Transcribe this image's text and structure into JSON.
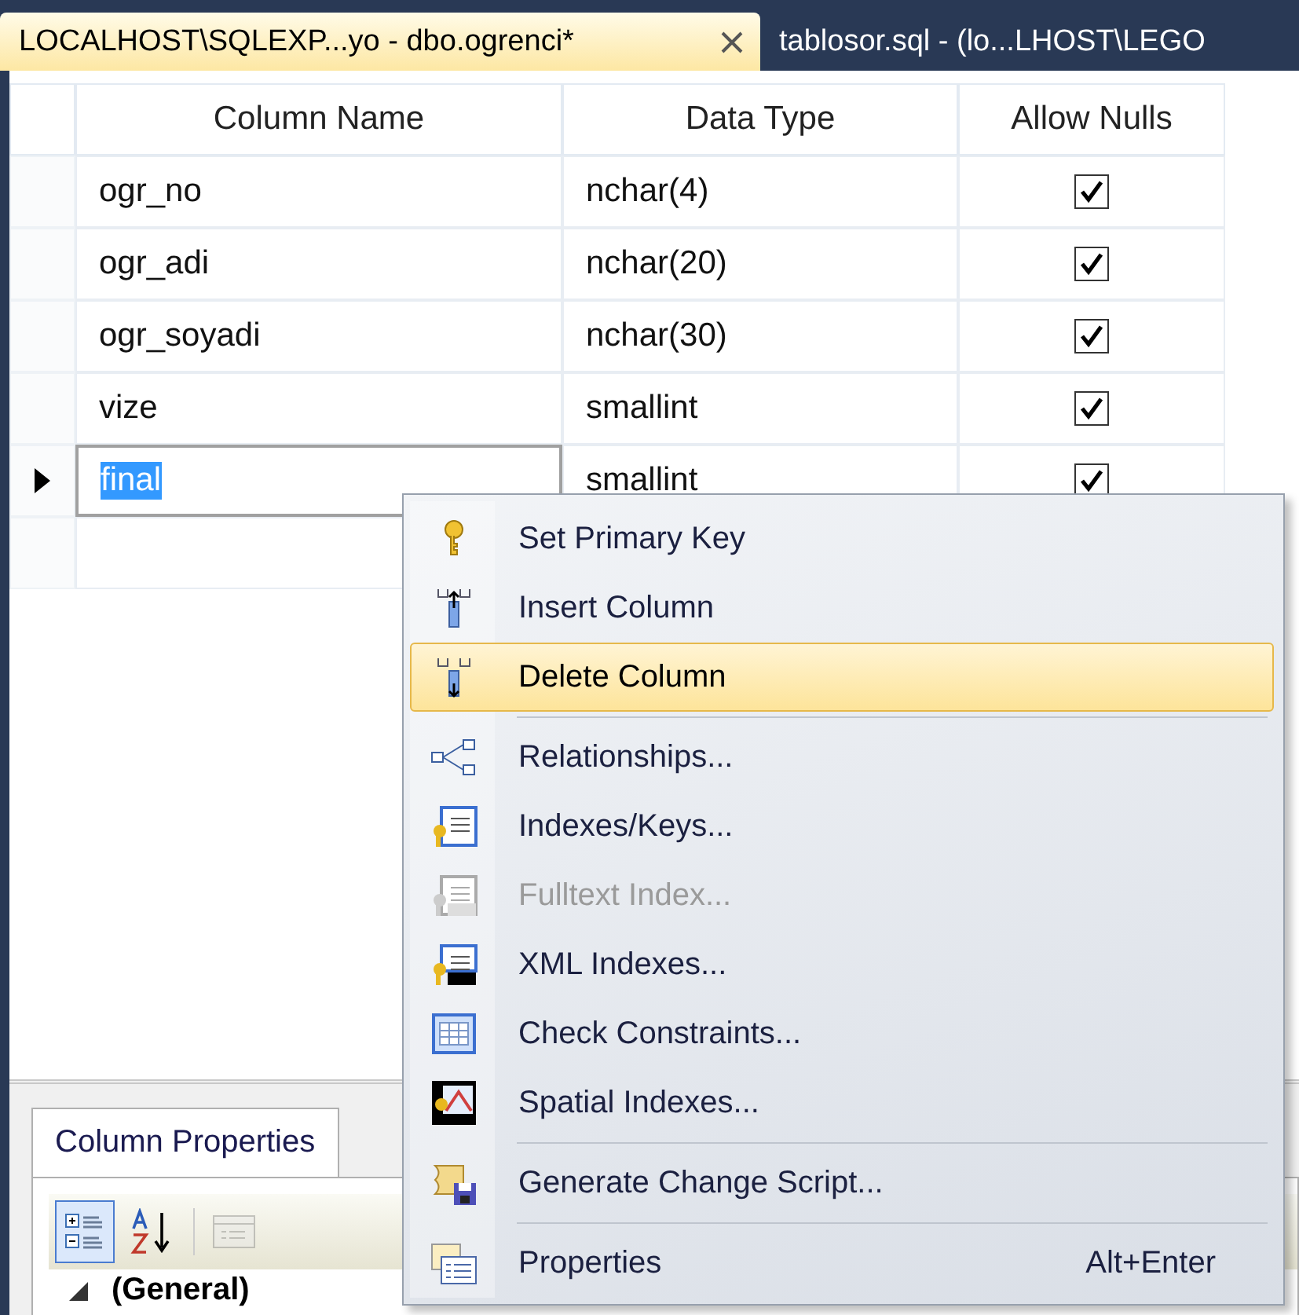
{
  "tabs": [
    {
      "title": "LOCALHOST\\SQLEXP...yo - dbo.ogrenci*",
      "selected": true,
      "closable": true
    },
    {
      "title": "tablosor.sql - (lo...LHOST\\LEGO",
      "selected": false,
      "closable": false
    }
  ],
  "table": {
    "columns": [
      "Column Name",
      "Data Type",
      "Allow Nulls"
    ],
    "rows": [
      {
        "name": "ogr_no",
        "type": "nchar(4)",
        "allow_nulls": true,
        "selected": false
      },
      {
        "name": "ogr_adi",
        "type": "nchar(20)",
        "allow_nulls": true,
        "selected": false
      },
      {
        "name": "ogr_soyadi",
        "type": "nchar(30)",
        "allow_nulls": true,
        "selected": false
      },
      {
        "name": "vize",
        "type": "smallint",
        "allow_nulls": true,
        "selected": false
      },
      {
        "name": "final",
        "type": "smallint",
        "allow_nulls": true,
        "selected": true
      }
    ]
  },
  "context_menu": {
    "items": [
      {
        "label": "Set Primary Key",
        "selected": false,
        "disabled": false,
        "separator_after": false
      },
      {
        "label": "Insert Column",
        "selected": false,
        "disabled": false,
        "separator_after": false
      },
      {
        "label": "Delete Column",
        "selected": true,
        "disabled": false,
        "separator_after": true
      },
      {
        "label": "Relationships...",
        "selected": false,
        "disabled": false,
        "separator_after": false
      },
      {
        "label": "Indexes/Keys...",
        "selected": false,
        "disabled": false,
        "separator_after": false
      },
      {
        "label": "Fulltext Index...",
        "selected": false,
        "disabled": true,
        "separator_after": false
      },
      {
        "label": "XML Indexes...",
        "selected": false,
        "disabled": false,
        "separator_after": false
      },
      {
        "label": "Check Constraints...",
        "selected": false,
        "disabled": false,
        "separator_after": false
      },
      {
        "label": "Spatial Indexes...",
        "selected": false,
        "disabled": false,
        "separator_after": true
      },
      {
        "label": "Generate Change Script...",
        "selected": false,
        "disabled": false,
        "separator_after": true
      },
      {
        "label": "Properties",
        "shortcut": "Alt+Enter",
        "selected": false,
        "disabled": false,
        "separator_after": false
      }
    ]
  },
  "properties_panel": {
    "tabs": [
      {
        "label": "Column Properties",
        "selected": true
      }
    ],
    "toolbar": [
      {
        "selected": true
      },
      {
        "selected": false
      },
      {
        "selected": false,
        "disabled": true
      }
    ],
    "categories": [
      {
        "label": "(General)",
        "expanded": true
      }
    ]
  }
}
